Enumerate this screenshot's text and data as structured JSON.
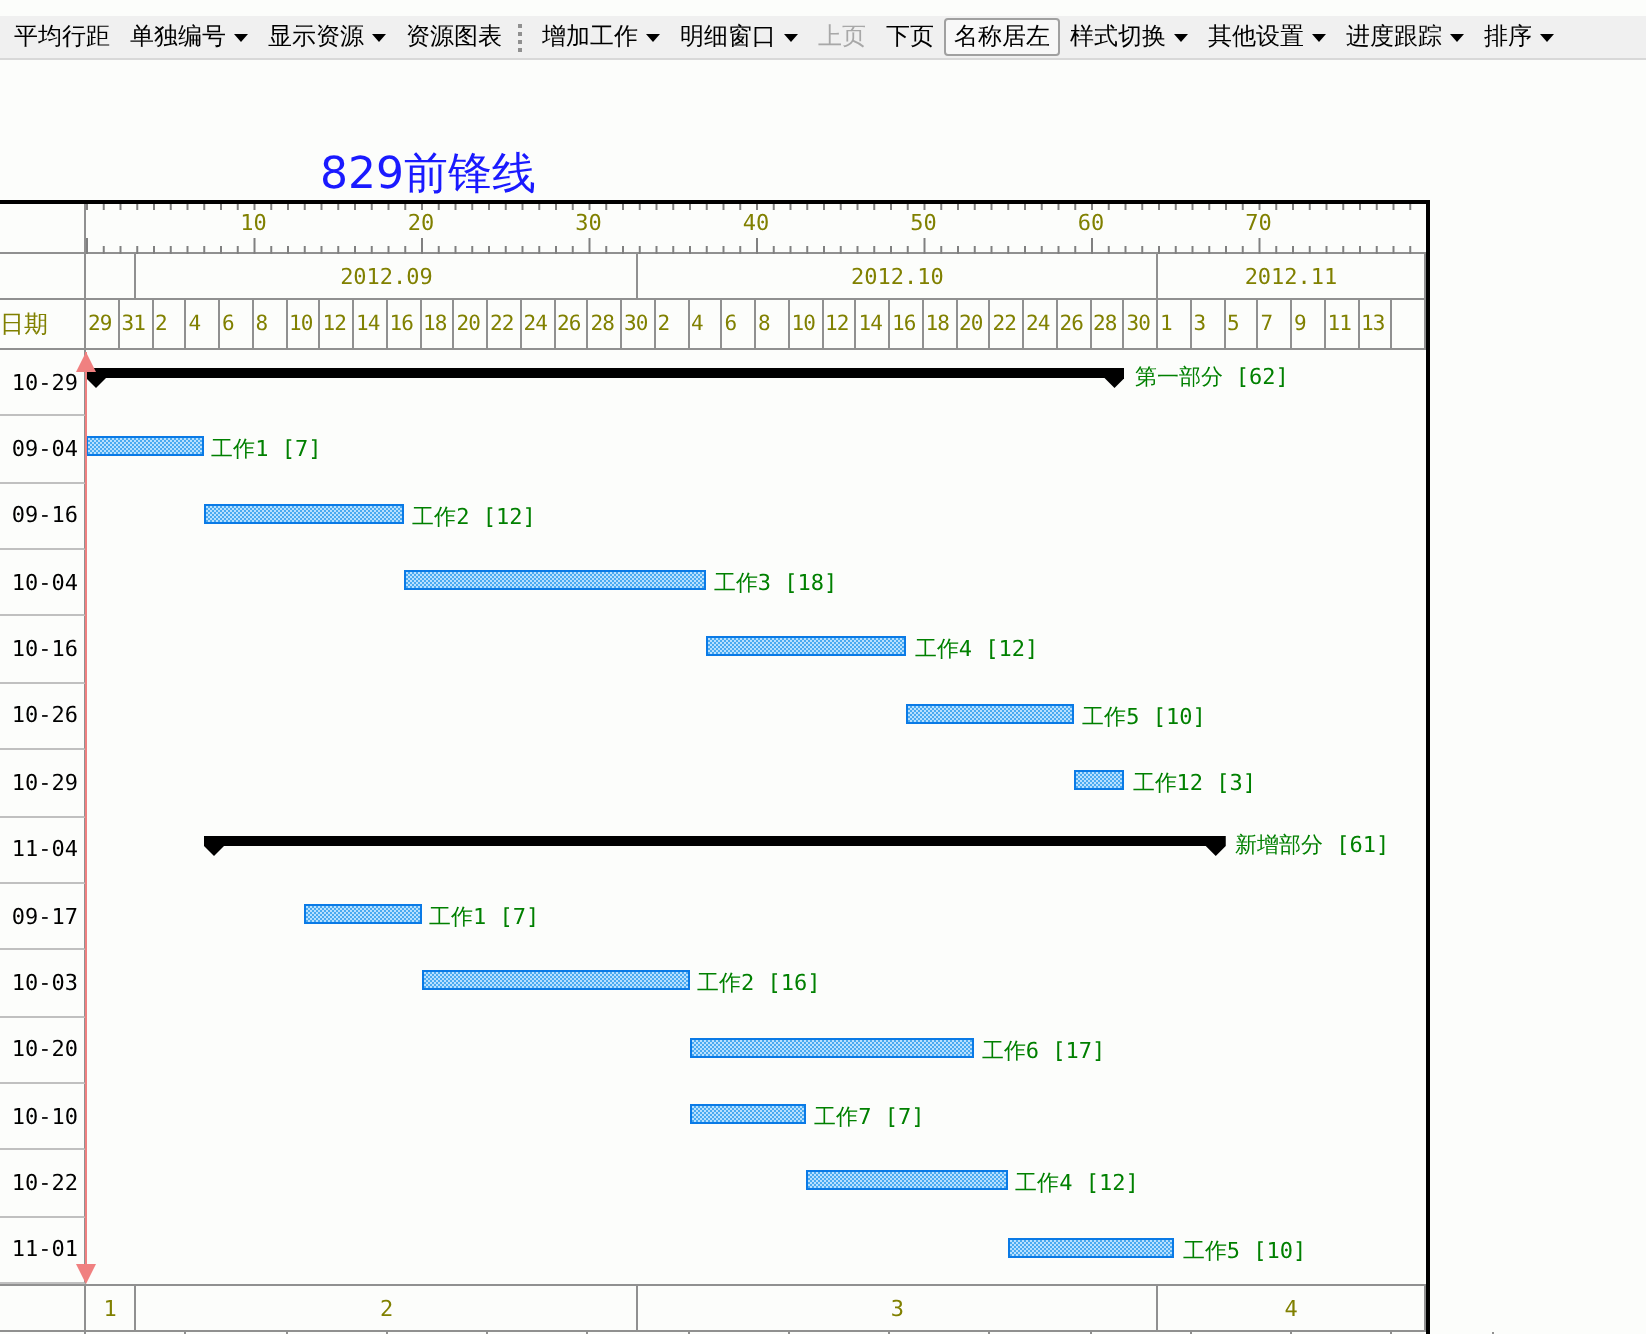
{
  "toolbar": [
    {
      "label": "平均行距",
      "kind": "button",
      "disabled": false,
      "pressed": false
    },
    {
      "label": "单独编号",
      "kind": "dropdown",
      "disabled": false,
      "pressed": false
    },
    {
      "label": "显示资源",
      "kind": "dropdown",
      "disabled": false,
      "pressed": false
    },
    {
      "label": "资源图表",
      "kind": "button",
      "disabled": false,
      "pressed": false
    },
    {
      "kind": "grip"
    },
    {
      "label": "增加工作",
      "kind": "dropdown",
      "disabled": false,
      "pressed": false
    },
    {
      "label": "明细窗口",
      "kind": "dropdown",
      "disabled": false,
      "pressed": false
    },
    {
      "label": "上页",
      "kind": "button",
      "disabled": true,
      "pressed": false
    },
    {
      "label": "下页",
      "kind": "button",
      "disabled": false,
      "pressed": false
    },
    {
      "label": "名称居左",
      "kind": "button",
      "disabled": false,
      "pressed": true
    },
    {
      "label": "样式切换",
      "kind": "dropdown",
      "disabled": false,
      "pressed": false
    },
    {
      "label": "其他设置",
      "kind": "dropdown",
      "disabled": false,
      "pressed": false
    },
    {
      "label": "进度跟踪",
      "kind": "dropdown",
      "disabled": false,
      "pressed": false
    },
    {
      "label": "排序",
      "kind": "dropdown",
      "disabled": false,
      "pressed": false
    }
  ],
  "title": "829前锋线",
  "timescale": {
    "ticks": [
      "10",
      "20",
      "30",
      "40",
      "50",
      "60",
      "70"
    ],
    "months": [
      "2012.09",
      "2012.10",
      "2012.11"
    ],
    "date_header": "日期",
    "days": [
      "29",
      "31",
      "2",
      "4",
      "6",
      "8",
      "10",
      "12",
      "14",
      "16",
      "18",
      "20",
      "22",
      "24",
      "26",
      "28",
      "30",
      "2",
      "4",
      "6",
      "8",
      "10",
      "12",
      "14",
      "16",
      "18",
      "20",
      "22",
      "24",
      "26",
      "28",
      "30",
      "1",
      "3",
      "5",
      "7",
      "9",
      "11",
      "13"
    ]
  },
  "tasks": [
    {
      "kind": "summary",
      "end": "10-29",
      "name": "第一部分",
      "duration": "[62]"
    },
    {
      "kind": "task",
      "end": "09-04",
      "name": "工作1",
      "duration": "[7]"
    },
    {
      "kind": "task",
      "end": "09-16",
      "name": "工作2",
      "duration": "[12]"
    },
    {
      "kind": "task",
      "end": "10-04",
      "name": "工作3",
      "duration": "[18]"
    },
    {
      "kind": "task",
      "end": "10-16",
      "name": "工作4",
      "duration": "[12]"
    },
    {
      "kind": "task",
      "end": "10-26",
      "name": "工作5",
      "duration": "[10]"
    },
    {
      "kind": "task",
      "end": "10-29",
      "name": "工作12",
      "duration": "[3]"
    },
    {
      "kind": "summary",
      "end": "11-04",
      "name": "新增部分",
      "duration": "[61]"
    },
    {
      "kind": "task",
      "end": "09-17",
      "name": "工作1",
      "duration": "[7]"
    },
    {
      "kind": "task",
      "end": "10-03",
      "name": "工作2",
      "duration": "[16]"
    },
    {
      "kind": "task",
      "end": "10-20",
      "name": "工作6",
      "duration": "[17]"
    },
    {
      "kind": "task",
      "end": "10-10",
      "name": "工作7",
      "duration": "[7]"
    },
    {
      "kind": "task",
      "end": "10-22",
      "name": "工作4",
      "duration": "[12]"
    },
    {
      "kind": "task",
      "end": "11-01",
      "name": "工作5",
      "duration": "[10]"
    }
  ],
  "periods": [
    "1",
    "2",
    "3",
    "4"
  ]
}
